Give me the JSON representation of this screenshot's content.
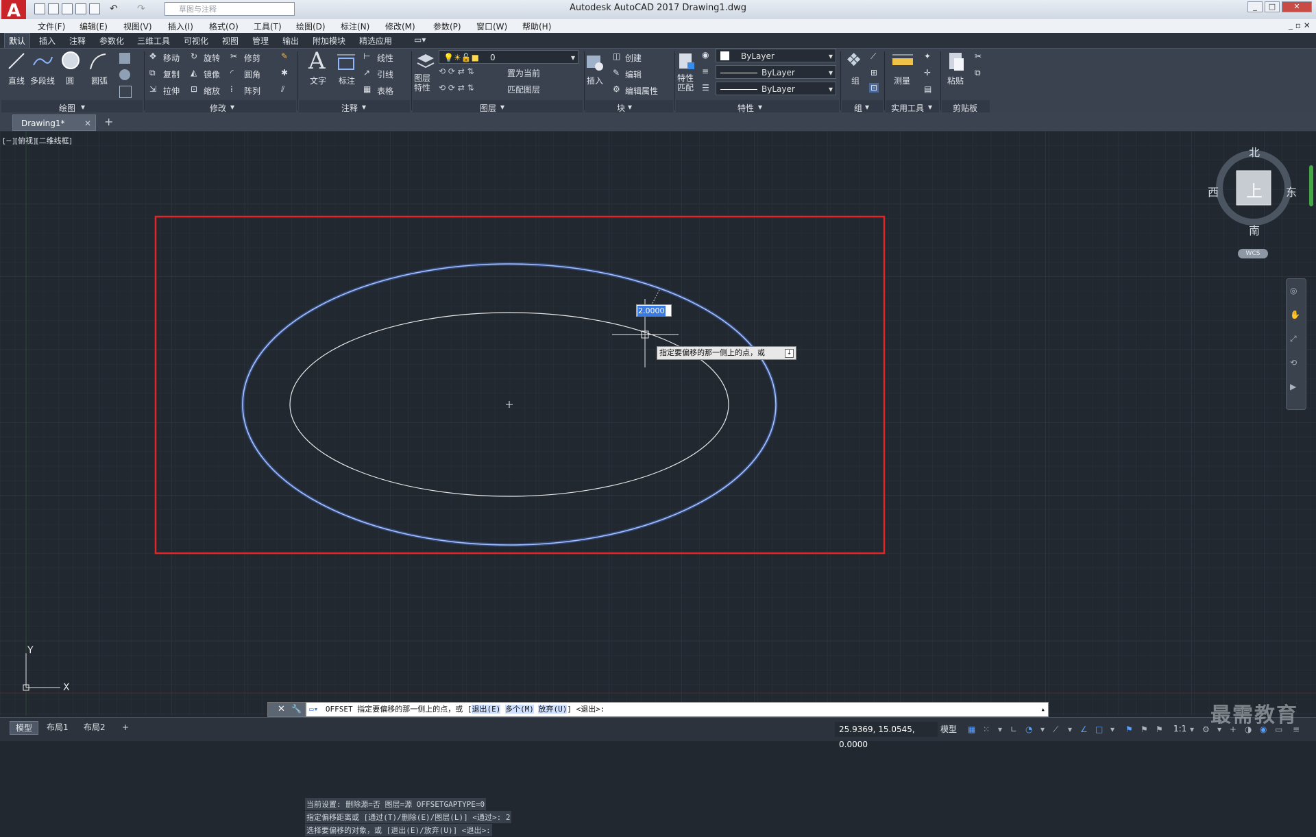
{
  "titlebar": {
    "title": "Autodesk AutoCAD 2017    Drawing1.dwg",
    "workspace": "草图与注释",
    "app_logo": "A"
  },
  "menu": [
    "文件(F)",
    "编辑(E)",
    "视图(V)",
    "插入(I)",
    "格式(O)",
    "工具(T)",
    "绘图(D)",
    "标注(N)",
    "修改(M)",
    "参数(P)",
    "窗口(W)",
    "帮助(H)"
  ],
  "ribbon_tabs": [
    "默认",
    "插入",
    "注释",
    "参数化",
    "三维工具",
    "可视化",
    "视图",
    "管理",
    "输出",
    "附加模块",
    "精选应用"
  ],
  "ribbon": {
    "draw": {
      "line": "直线",
      "polyline": "多段线",
      "circle": "圆",
      "arc": "圆弧",
      "panel": "绘图"
    },
    "modify": {
      "move": "移动",
      "rotate": "旋转",
      "trim": "修剪",
      "copy": "复制",
      "mirror": "镜像",
      "fillet": "圆角",
      "stretch": "拉伸",
      "scale": "缩放",
      "array": "阵列",
      "panel": "修改"
    },
    "annotation": {
      "text": "文字",
      "dimension": "标注",
      "linear": "线性",
      "leader": "引线",
      "table": "表格",
      "panel": "注释"
    },
    "layers": {
      "layer_props": "图层\n特性",
      "current_layer": "0",
      "make_current": "置为当前",
      "match_layer": "匹配图层",
      "panel": "图层"
    },
    "block": {
      "insert": "插入",
      "create": "创建",
      "edit": "编辑",
      "edit_attr": "编辑属性",
      "panel": "块"
    },
    "properties": {
      "match": "特性\n匹配",
      "color": "ByLayer",
      "linetype": "ByLayer",
      "lineweight": "ByLayer",
      "panel": "特性"
    },
    "groups": {
      "group": "组",
      "panel": "组"
    },
    "utilities": {
      "measure": "测量",
      "panel": "实用工具"
    },
    "clipboard": {
      "paste": "粘贴",
      "panel": "剪贴板"
    }
  },
  "document": {
    "tab": "Drawing1*",
    "viewport_label": "[−][俯视][二维线框]"
  },
  "viewcube": {
    "north": "北",
    "south": "南",
    "east": "东",
    "west": "西",
    "top": "上",
    "wcs": "WCS"
  },
  "tooltip": {
    "distance_value": "2.0000",
    "prompt": "指定要偏移的那一侧上的点，或"
  },
  "ucs": {
    "x": "X",
    "y": "Y"
  },
  "command": {
    "history": [
      "当前设置: 删除源=否  图层=源  OFFSETGAPTYPE=0",
      "指定偏移距离或 [通过(T)/删除(E)/图层(L)] <通过>:  2",
      "选择要偏移的对象，或 [退出(E)/放弃(U)] <退出>:"
    ],
    "prompt_prefix": "OFFSET 指定要偏移的那一侧上的点，或 [",
    "opt_exit": "退出(E)",
    "opt_multiple": "多个(M)",
    "opt_undo": "放弃(U)",
    "prompt_suffix": "] <退出>:"
  },
  "status": {
    "tabs": [
      "模型",
      "布局1",
      "布局2"
    ],
    "coords": "25.9369, 15.0545, 0.0000",
    "model_label": "模型",
    "scale": "1:1"
  },
  "watermark": "最需教育",
  "colors": {
    "accent_red": "#e02626",
    "selected_ellipse": "#7ea3ff",
    "offset_ellipse": "#e8e8e8",
    "canvas_bg": "#212830"
  }
}
